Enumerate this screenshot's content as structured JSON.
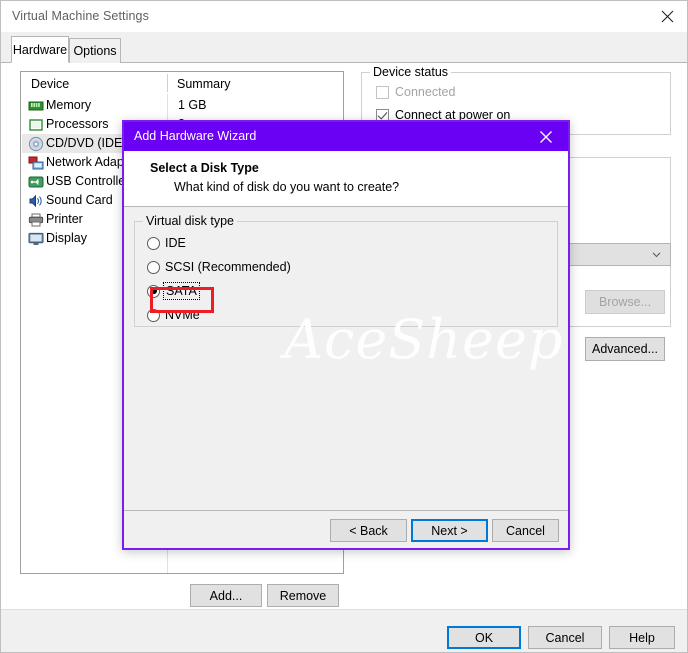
{
  "window": {
    "title": "Virtual Machine Settings",
    "close_icon": "close-icon"
  },
  "tabs": [
    {
      "id": "hardware",
      "label": "Hardware",
      "active": true
    },
    {
      "id": "options",
      "label": "Options",
      "active": false
    }
  ],
  "device_list": {
    "columns": {
      "device": "Device",
      "summary": "Summary"
    },
    "rows": [
      {
        "name": "Memory",
        "summary": "1 GB",
        "icon": "memory-icon",
        "selected": false
      },
      {
        "name": "Processors",
        "summary": "2",
        "icon": "cpu-icon",
        "selected": false
      },
      {
        "name": "CD/DVD (IDE)",
        "summary": "",
        "icon": "disc-icon",
        "selected": true
      },
      {
        "name": "Network Adapter",
        "summary": "",
        "icon": "network-icon",
        "selected": false
      },
      {
        "name": "USB Controller",
        "summary": "",
        "icon": "usb-icon",
        "selected": false
      },
      {
        "name": "Sound Card",
        "summary": "",
        "icon": "speaker-icon",
        "selected": false
      },
      {
        "name": "Printer",
        "summary": "",
        "icon": "printer-icon",
        "selected": false
      },
      {
        "name": "Display",
        "summary": "",
        "icon": "display-icon",
        "selected": false
      }
    ]
  },
  "device_status": {
    "group_label": "Device status",
    "connected": {
      "label": "Connected",
      "checked": false,
      "disabled": true
    },
    "connect_at_power_on": {
      "label": "Connect at power on",
      "checked": true,
      "disabled": false
    }
  },
  "connection": {
    "browse_label": "Browse...",
    "browse_disabled": true
  },
  "advanced_label": "Advanced...",
  "list_buttons": {
    "add": "Add...",
    "remove": "Remove"
  },
  "footer_buttons": {
    "ok": "OK",
    "cancel": "Cancel",
    "help": "Help"
  },
  "wizard": {
    "title": "Add Hardware Wizard",
    "close_icon": "close-icon",
    "heading": "Select a Disk Type",
    "subheading": "What kind of disk do you want to create?",
    "group_label": "Virtual disk type",
    "options": [
      {
        "label": "IDE",
        "checked": false,
        "focused": false
      },
      {
        "label": "SCSI   (Recommended)",
        "checked": false,
        "focused": false
      },
      {
        "label": "SATA",
        "checked": true,
        "focused": true
      },
      {
        "label": "NVMe",
        "checked": false,
        "focused": false
      }
    ],
    "buttons": {
      "back": "< Back",
      "next": "Next >",
      "cancel": "Cancel"
    }
  },
  "watermark": {
    "text": "AceSheep Blog"
  },
  "colors": {
    "wizard_title_bar": "#6a00f4",
    "wizard_border": "#7a1ef0",
    "focus_blue": "#0078d7",
    "highlight_red": "#ee1c25",
    "window_bg": "#ffffff",
    "panel_bg": "#f0f0f0"
  }
}
